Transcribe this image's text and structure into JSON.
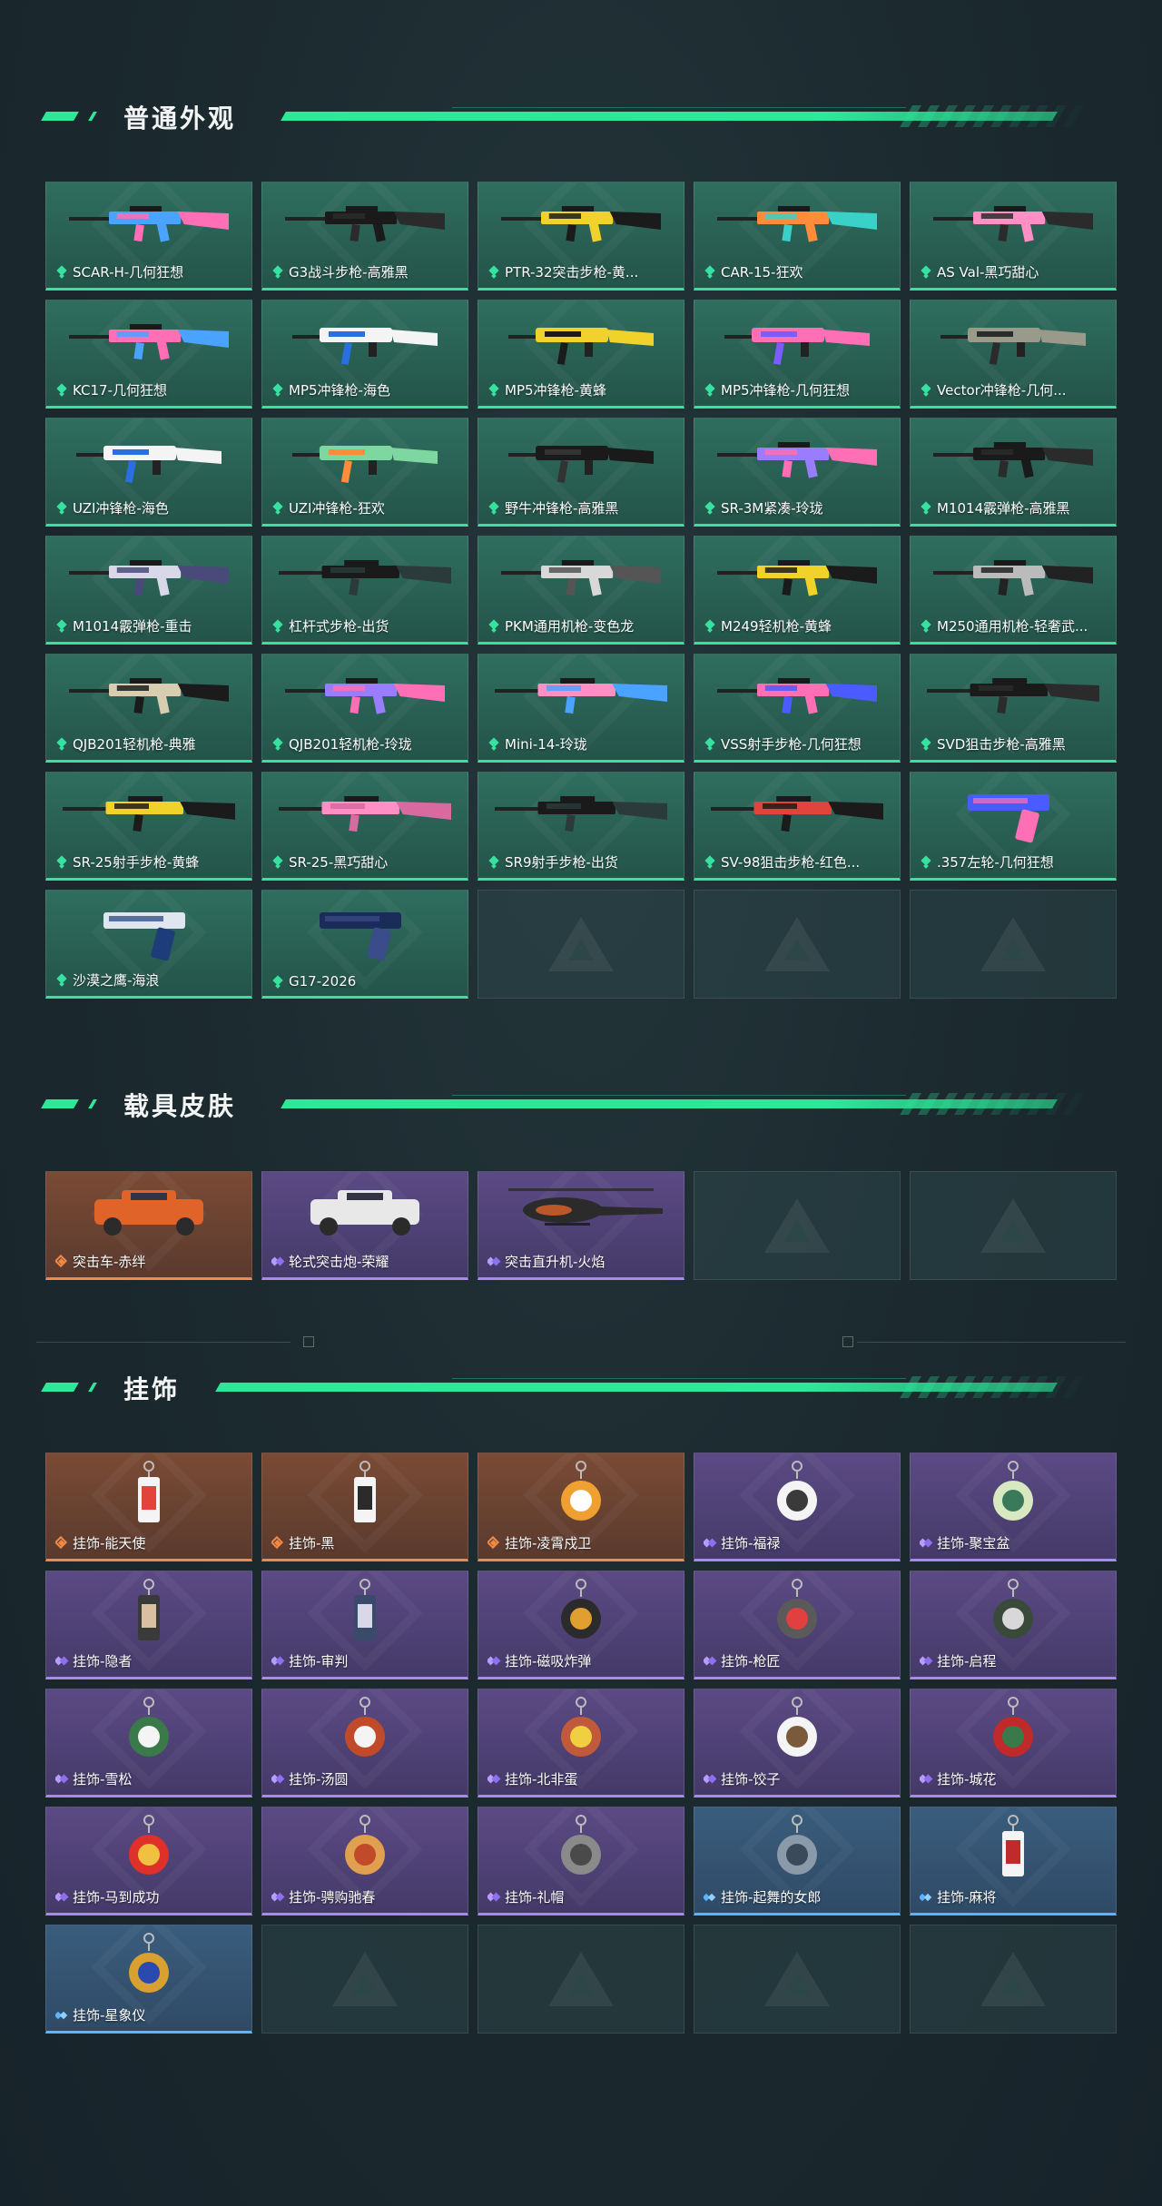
{
  "sections": [
    {
      "title": "普通外观",
      "items": [
        {
          "label": "SCAR-H-几何狂想",
          "rarity": "green",
          "icon": "rifle-scar-h-pink-blue-skin",
          "kind": "rifle",
          "colors": [
            "#4aa3ff",
            "#ff6fb5"
          ]
        },
        {
          "label": "G3战斗步枪-高雅黑",
          "rarity": "green",
          "icon": "rifle-g3-black-skin",
          "kind": "rifle",
          "colors": [
            "#1a1a1a",
            "#2b2b2b"
          ]
        },
        {
          "label": "PTR-32突击步枪-黄...",
          "rarity": "green",
          "icon": "rifle-ptr32-yellow-skin",
          "kind": "rifle",
          "colors": [
            "#f1d22a",
            "#1b1b1b"
          ]
        },
        {
          "label": "CAR-15-狂欢",
          "rarity": "green",
          "icon": "rifle-car15-party-skin",
          "kind": "rifle",
          "colors": [
            "#ff8c3a",
            "#3ad1c8"
          ]
        },
        {
          "label": "AS Val-黑巧甜心",
          "rarity": "green",
          "icon": "rifle-asval-pink-skin",
          "kind": "rifle",
          "colors": [
            "#ff8fc4",
            "#2b2b2b"
          ]
        },
        {
          "label": "KC17-几何狂想",
          "rarity": "green",
          "icon": "rifle-kc17-pink-blue-skin",
          "kind": "rifle",
          "colors": [
            "#ff6fb5",
            "#4aa3ff"
          ]
        },
        {
          "label": "MP5冲锋枪-海色",
          "rarity": "green",
          "icon": "smg-mp5-white-blue-skin",
          "kind": "smg",
          "colors": [
            "#f4f4f4",
            "#2a6fe0"
          ]
        },
        {
          "label": "MP5冲锋枪-黄蜂",
          "rarity": "green",
          "icon": "smg-mp5-yellow-skin",
          "kind": "smg",
          "colors": [
            "#f1d22a",
            "#1b1b1b"
          ]
        },
        {
          "label": "MP5冲锋枪-几何狂想",
          "rarity": "green",
          "icon": "smg-mp5-pink-blue-skin",
          "kind": "smg",
          "colors": [
            "#ff6fb5",
            "#7a5cff"
          ]
        },
        {
          "label": "Vector冲锋枪-几何...",
          "rarity": "green",
          "icon": "smg-vector-camo-skin",
          "kind": "smg",
          "colors": [
            "#9a9a8a",
            "#2b2b2b"
          ]
        },
        {
          "label": "UZI冲锋枪-海色",
          "rarity": "green",
          "icon": "smg-uzi-white-blue-skin",
          "kind": "smg",
          "colors": [
            "#f4f4f4",
            "#2a6fe0"
          ]
        },
        {
          "label": "UZI冲锋枪-狂欢",
          "rarity": "green",
          "icon": "smg-uzi-party-skin",
          "kind": "smg",
          "colors": [
            "#7ed6a0",
            "#ff8c3a"
          ]
        },
        {
          "label": "野牛冲锋枪-高雅黑",
          "rarity": "green",
          "icon": "smg-bizon-black-skin",
          "kind": "smg",
          "colors": [
            "#1a1a1a",
            "#333"
          ]
        },
        {
          "label": "SR-3M紧凑-玲珑",
          "rarity": "green",
          "icon": "rifle-sr3m-purple-skin",
          "kind": "rifle",
          "colors": [
            "#9a7cff",
            "#ff6fb5"
          ]
        },
        {
          "label": "M1014霰弹枪-高雅黑",
          "rarity": "green",
          "icon": "shotgun-m1014-black-skin",
          "kind": "shotgun",
          "colors": [
            "#1a1a1a",
            "#2b2b2b"
          ]
        },
        {
          "label": "M1014霰弹枪-重击",
          "rarity": "green",
          "icon": "shotgun-m1014-white-skin",
          "kind": "shotgun",
          "colors": [
            "#d8d8e8",
            "#4a4a7a"
          ]
        },
        {
          "label": "杠杆式步枪-出货",
          "rarity": "green",
          "icon": "rifle-lever-black-skin",
          "kind": "sniper",
          "colors": [
            "#1a1a1a",
            "#2b3b3b"
          ]
        },
        {
          "label": "PKM通用机枪-变色龙",
          "rarity": "green",
          "icon": "lmg-pkm-chameleon-skin",
          "kind": "lmg",
          "colors": [
            "#d8d8d8",
            "#555"
          ]
        },
        {
          "label": "M249轻机枪-黄蜂",
          "rarity": "green",
          "icon": "lmg-m249-yellow-skin",
          "kind": "lmg",
          "colors": [
            "#f1d22a",
            "#1b1b1b"
          ]
        },
        {
          "label": "M250通用机枪-轻奢武...",
          "rarity": "green",
          "icon": "lmg-m250-silver-skin",
          "kind": "lmg",
          "colors": [
            "#bbb",
            "#222"
          ]
        },
        {
          "label": "QJB201轻机枪-典雅",
          "rarity": "green",
          "icon": "lmg-qjb201-tan-skin",
          "kind": "lmg",
          "colors": [
            "#d8cdb0",
            "#1b1b1b"
          ]
        },
        {
          "label": "QJB201轻机枪-玲珑",
          "rarity": "green",
          "icon": "lmg-qjb201-purple-skin",
          "kind": "lmg",
          "colors": [
            "#9a7cff",
            "#ff6fb5"
          ]
        },
        {
          "label": "Mini-14-玲珑",
          "rarity": "green",
          "icon": "rifle-mini14-rainbow-skin",
          "kind": "sniper",
          "colors": [
            "#ff8fc4",
            "#4aa3ff"
          ]
        },
        {
          "label": "VSS射手步枪-几何狂想",
          "rarity": "green",
          "icon": "rifle-vss-pink-blue-skin",
          "kind": "rifle",
          "colors": [
            "#ff6fb5",
            "#4a5cff"
          ]
        },
        {
          "label": "SVD狙击步枪-高雅黑",
          "rarity": "green",
          "icon": "sniper-svd-black-skin",
          "kind": "sniper",
          "colors": [
            "#1a1a1a",
            "#2b2b2b"
          ]
        },
        {
          "label": "SR-25射手步枪-黄蜂",
          "rarity": "green",
          "icon": "rifle-sr25-yellow-skin",
          "kind": "sniper",
          "colors": [
            "#f1d22a",
            "#1b1b1b"
          ]
        },
        {
          "label": "SR-25-黑巧甜心",
          "rarity": "green",
          "icon": "rifle-sr25-pink-skin",
          "kind": "sniper",
          "colors": [
            "#ff8fc4",
            "#d86aa0"
          ]
        },
        {
          "label": "SR9射手步枪-出货",
          "rarity": "green",
          "icon": "rifle-sr9-black-skin",
          "kind": "sniper",
          "colors": [
            "#1a1a1a",
            "#2b3b3b"
          ]
        },
        {
          "label": "SV-98狙击步枪-红色...",
          "rarity": "green",
          "icon": "sniper-sv98-red-skin",
          "kind": "sniper",
          "colors": [
            "#e0443a",
            "#1b1b1b"
          ]
        },
        {
          "label": ".357左轮-几何狂想",
          "rarity": "green",
          "icon": "revolver-357-pink-blue-skin",
          "kind": "pistol",
          "colors": [
            "#4a5cff",
            "#ff6fb5"
          ]
        },
        {
          "label": "沙漠之鹰-海浪",
          "rarity": "green",
          "icon": "pistol-deagle-wave-skin",
          "kind": "pistol",
          "colors": [
            "#dfe6f0",
            "#1c3c7a"
          ]
        },
        {
          "label": "G17-2026",
          "rarity": "green",
          "icon": "pistol-g17-navy-skin",
          "kind": "pistol",
          "colors": [
            "#1c2c5a",
            "#3a4c8a"
          ]
        },
        {
          "empty": true
        },
        {
          "empty": true
        },
        {
          "empty": true
        }
      ]
    },
    {
      "title": "载具皮肤",
      "items": [
        {
          "label": "突击车-赤绊",
          "rarity": "orange",
          "icon": "assault-vehicle-red-skin",
          "kind": "vehicle",
          "colors": [
            "#e0642a",
            "#2b2b2b"
          ]
        },
        {
          "label": "轮式突击炮-荣耀",
          "rarity": "purple",
          "icon": "wheeled-assault-gun-white-skin",
          "kind": "vehicle",
          "colors": [
            "#e8e8e8",
            "#2b2b2b"
          ]
        },
        {
          "label": "突击直升机-火焰",
          "rarity": "purple",
          "icon": "assault-helicopter-flame-skin",
          "kind": "heli",
          "colors": [
            "#2b2b2b",
            "#e0642a"
          ]
        },
        {
          "empty": true
        },
        {
          "empty": true
        }
      ]
    },
    {
      "title": "挂饰",
      "items": [
        {
          "label": "挂饰-能天使",
          "rarity": "orange",
          "icon": "charm-exusiai-tag",
          "kind": "tag",
          "colors": [
            "#f4f4f4",
            "#e0443a"
          ]
        },
        {
          "label": "挂饰-黑",
          "rarity": "orange",
          "icon": "charm-black-tag",
          "kind": "tag",
          "colors": [
            "#f4f4f4",
            "#2b2b2b"
          ]
        },
        {
          "label": "挂饰-凌霄戍卫",
          "rarity": "orange",
          "icon": "charm-guardian-figure",
          "kind": "charm",
          "colors": [
            "#f0a030",
            "#fff"
          ]
        },
        {
          "label": "挂饰-福禄",
          "rarity": "purple",
          "icon": "charm-fortune-figure",
          "kind": "charm",
          "colors": [
            "#f4f4f4",
            "#3a3a3a"
          ]
        },
        {
          "label": "挂饰-聚宝盆",
          "rarity": "purple",
          "icon": "charm-treasure-bowl",
          "kind": "charm",
          "colors": [
            "#d8e8c0",
            "#3a7a5a"
          ]
        },
        {
          "label": "挂饰-隐者",
          "rarity": "purple",
          "icon": "charm-hermit-card",
          "kind": "tag",
          "colors": [
            "#3a3a3a",
            "#d8c0a0"
          ]
        },
        {
          "label": "挂饰-审判",
          "rarity": "purple",
          "icon": "charm-judgement-card",
          "kind": "tag",
          "colors": [
            "#3a4a6a",
            "#d8d8e8"
          ]
        },
        {
          "label": "挂饰-磁吸炸弹",
          "rarity": "purple",
          "icon": "charm-magnetic-bomb",
          "kind": "charm",
          "colors": [
            "#2b2b2b",
            "#e0a030"
          ]
        },
        {
          "label": "挂饰-枪匠",
          "rarity": "purple",
          "icon": "charm-gunsmith-box",
          "kind": "charm",
          "colors": [
            "#5a5a5a",
            "#e04040"
          ]
        },
        {
          "label": "挂饰-启程",
          "rarity": "purple",
          "icon": "charm-departure-compass",
          "kind": "charm",
          "colors": [
            "#3a4a3a",
            "#d8d8d8"
          ]
        },
        {
          "label": "挂饰-雪松",
          "rarity": "purple",
          "icon": "charm-snow-pine",
          "kind": "charm",
          "colors": [
            "#3a7a4a",
            "#f4f4f4"
          ]
        },
        {
          "label": "挂饰-汤圆",
          "rarity": "purple",
          "icon": "charm-tangyuan",
          "kind": "charm",
          "colors": [
            "#c04a2a",
            "#f4f4f4"
          ]
        },
        {
          "label": "挂饰-北非蛋",
          "rarity": "purple",
          "icon": "charm-shakshuka",
          "kind": "charm",
          "colors": [
            "#c05a3a",
            "#f0d040"
          ]
        },
        {
          "label": "挂饰-饺子",
          "rarity": "purple",
          "icon": "charm-dumpling",
          "kind": "charm",
          "colors": [
            "#f4f4f4",
            "#7a5a3a"
          ]
        },
        {
          "label": "挂饰-城花",
          "rarity": "purple",
          "icon": "charm-city-flower",
          "kind": "charm",
          "colors": [
            "#c02a2a",
            "#3a7a4a"
          ]
        },
        {
          "label": "挂饰-马到成功",
          "rarity": "purple",
          "icon": "charm-horse-success",
          "kind": "charm",
          "colors": [
            "#e0302a",
            "#f0c040"
          ]
        },
        {
          "label": "挂饰-骋购驰春",
          "rarity": "purple",
          "icon": "charm-spring-carriage",
          "kind": "charm",
          "colors": [
            "#e0a050",
            "#c04a2a"
          ]
        },
        {
          "label": "挂饰-礼帽",
          "rarity": "purple",
          "icon": "charm-top-hat",
          "kind": "charm",
          "colors": [
            "#8a8a8a",
            "#4a4a4a"
          ]
        },
        {
          "label": "挂饰-起舞的女郎",
          "rarity": "blue",
          "icon": "charm-dancing-lady",
          "kind": "charm",
          "colors": [
            "#8a9aa8",
            "#3a4a5a"
          ]
        },
        {
          "label": "挂饰-麻将",
          "rarity": "blue",
          "icon": "charm-mahjong-tile",
          "kind": "tag",
          "colors": [
            "#f4f4f4",
            "#c02a2a"
          ]
        },
        {
          "label": "挂饰-星象仪",
          "rarity": "blue",
          "icon": "charm-astrolabe",
          "kind": "charm",
          "colors": [
            "#d8a030",
            "#2a4ab0"
          ]
        },
        {
          "empty": true
        },
        {
          "empty": true
        },
        {
          "empty": true
        },
        {
          "empty": true
        }
      ]
    }
  ]
}
